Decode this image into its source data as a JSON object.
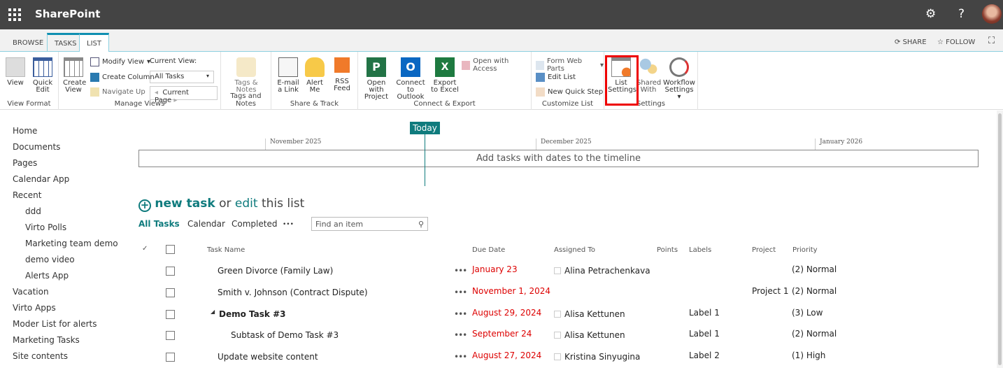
{
  "app": {
    "title": "SharePoint",
    "icons": [
      "app-launcher-icon",
      "gear-icon",
      "help-icon",
      "avatar"
    ]
  },
  "tabs": [
    {
      "label": "BROWSE"
    },
    {
      "label": "TASKS"
    },
    {
      "label": "LIST",
      "selected": true
    }
  ],
  "top_right": {
    "share": "SHARE",
    "follow": "FOLLOW"
  },
  "ribbon": {
    "view_format": {
      "label": "View Format",
      "view": "View",
      "quick_edit": "Quick Edit"
    },
    "manage_views": {
      "label": "Manage Views",
      "create_view": "Create View",
      "modify_view": "Modify View",
      "create_column": "Create Column",
      "navigate_up": "Navigate Up",
      "current_view_label": "Current View:",
      "current_view_value": "All Tasks",
      "current_page": "Current Page"
    },
    "tags": {
      "label": "Tags and Notes",
      "tags_notes": "Tags & Notes"
    },
    "share_track": {
      "label": "Share & Track",
      "email": "E-mail a Link",
      "alert": "Alert Me",
      "rss": "RSS Feed"
    },
    "connect": {
      "label": "Connect & Export",
      "project": "Open with Project",
      "outlook": "Connect to Outlook",
      "excel": "Export to Excel",
      "access": "Open with Access"
    },
    "customize": {
      "label": "Customize List",
      "form_web_parts": "Form Web Parts",
      "edit_list": "Edit List",
      "new_quick_step": "New Quick Step"
    },
    "settings": {
      "label": "Settings",
      "list_settings": "List Settings",
      "shared_with": "Shared With",
      "workflow": "Workflow Settings"
    }
  },
  "nav": [
    {
      "label": "Home"
    },
    {
      "label": "Documents"
    },
    {
      "label": "Pages"
    },
    {
      "label": "Calendar App"
    },
    {
      "label": "Recent"
    },
    {
      "label": "ddd",
      "sub": true
    },
    {
      "label": "Virto Polls",
      "sub": true
    },
    {
      "label": "Marketing team demo",
      "sub": true
    },
    {
      "label": "demo video",
      "sub": true
    },
    {
      "label": "Alerts App",
      "sub": true
    },
    {
      "label": "Vacation"
    },
    {
      "label": "Virto Apps"
    },
    {
      "label": "Moder List for alerts"
    },
    {
      "label": "Marketing Tasks"
    },
    {
      "label": "Site contents"
    }
  ],
  "timeline": {
    "today": "Today",
    "months": [
      "November 2025",
      "December 2025",
      "January 2026"
    ],
    "placeholder": "Add tasks with dates to the timeline"
  },
  "list": {
    "new_task": "new task",
    "or": "or",
    "edit": "edit",
    "this_list": "this list",
    "views": [
      "All Tasks",
      "Calendar",
      "Completed",
      "•••"
    ],
    "search_placeholder": "Find an item",
    "columns": [
      "Task Name",
      "Due Date",
      "Assigned To",
      "Points",
      "Labels",
      "Project",
      "Priority"
    ],
    "rows": [
      {
        "name": "Green Divorce (Family Law)",
        "due": "January 23",
        "assigned": "Alina Petrachenkava",
        "labels": "",
        "project": "",
        "priority": "(2) Normal"
      },
      {
        "name": "Smith v. Johnson (Contract Dispute)",
        "due": "November 1, 2024",
        "assigned": "",
        "labels": "",
        "project": "Project 1",
        "priority": "(2) Normal"
      },
      {
        "name": "Demo Task #3",
        "due": "August 29, 2024",
        "assigned": "Alisa Kettunen",
        "labels": "Label 1",
        "project": "",
        "priority": "(3) Low",
        "bold": true
      },
      {
        "name": "Subtask of Demo Task #3",
        "due": "September 24",
        "assigned": "Alisa Kettunen",
        "labels": "Label 1",
        "project": "",
        "priority": "(2) Normal",
        "sub": true
      },
      {
        "name": "Update website content",
        "due": "August 27, 2024",
        "assigned": "Kristina Sinyugina",
        "labels": "Label 2",
        "project": "",
        "priority": "(1) High"
      }
    ]
  },
  "colors": {
    "accent": "#0f7b7d",
    "overdue": "#dd0000",
    "topbar": "#444444",
    "highlight": "#ee0000"
  }
}
